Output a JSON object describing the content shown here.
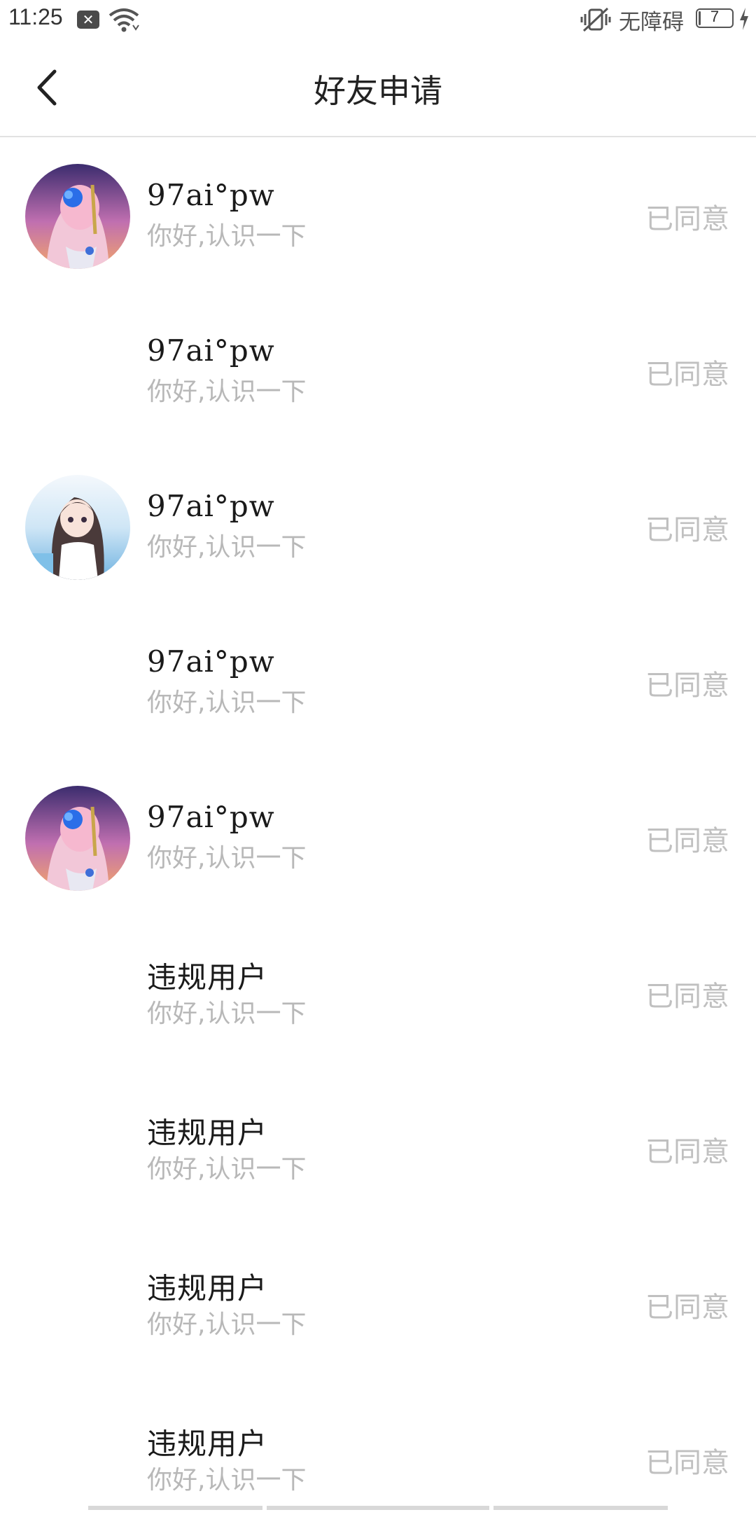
{
  "status_bar": {
    "time": "11:25",
    "notification_icon": "close-box-icon",
    "wifi_icon": "wifi-icon",
    "vibrate_icon": "vibrate-icon",
    "accessibility_text": "无障碍",
    "battery_level": "7",
    "battery_fraction": 0.07,
    "charging_icon": "charging-bolt-icon"
  },
  "header": {
    "back_icon": "chevron-left-icon",
    "title": "好友申请"
  },
  "requests": [
    {
      "name": "97ai°pw",
      "message": "你好,认识一下",
      "status": "已同意",
      "avatar": "anime-girl-pink-hair"
    },
    {
      "name": "97ai°pw",
      "message": "你好,认识一下",
      "status": "已同意",
      "avatar": "none"
    },
    {
      "name": "97ai°pw",
      "message": "你好,认识一下",
      "status": "已同意",
      "avatar": "anime-girl-beach"
    },
    {
      "name": "97ai°pw",
      "message": "你好,认识一下",
      "status": "已同意",
      "avatar": "none"
    },
    {
      "name": "97ai°pw",
      "message": "你好,认识一下",
      "status": "已同意",
      "avatar": "anime-girl-pink-hair"
    },
    {
      "name": "违规用户",
      "message": "你好,认识一下",
      "status": "已同意",
      "avatar": "none"
    },
    {
      "name": "违规用户",
      "message": "你好,认识一下",
      "status": "已同意",
      "avatar": "none"
    },
    {
      "name": "违规用户",
      "message": "你好,认识一下",
      "status": "已同意",
      "avatar": "none"
    },
    {
      "name": "违规用户",
      "message": "你好,认识一下",
      "status": "已同意",
      "avatar": "none"
    }
  ],
  "colors": {
    "name_text": "#1a1a1a",
    "message_text": "#b8b8b8",
    "status_text": "#c0c0c0",
    "divider": "#e2e2e2"
  }
}
